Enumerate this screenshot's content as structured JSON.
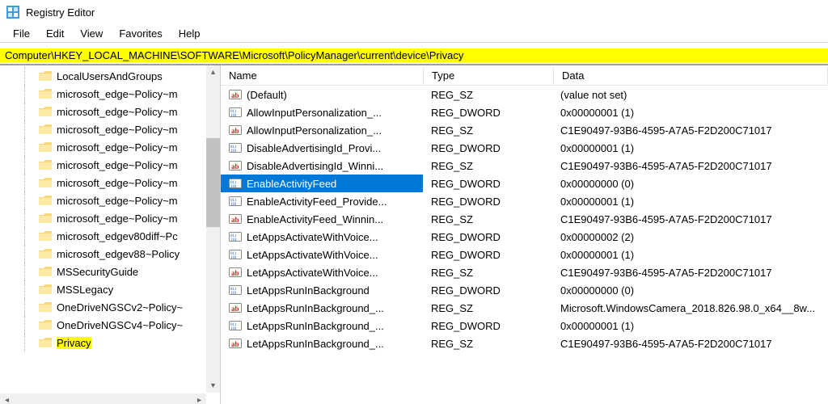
{
  "window": {
    "title": "Registry Editor"
  },
  "menu": {
    "items": [
      "File",
      "Edit",
      "View",
      "Favorites",
      "Help"
    ]
  },
  "address": {
    "path": "Computer\\HKEY_LOCAL_MACHINE\\SOFTWARE\\Microsoft\\PolicyManager\\current\\device\\Privacy"
  },
  "columns": {
    "name": "Name",
    "type": "Type",
    "data": "Data"
  },
  "tree": {
    "items": [
      {
        "label": "LocalUsersAndGroups",
        "selected": false
      },
      {
        "label": "microsoft_edge~Policy~m",
        "selected": false
      },
      {
        "label": "microsoft_edge~Policy~m",
        "selected": false
      },
      {
        "label": "microsoft_edge~Policy~m",
        "selected": false
      },
      {
        "label": "microsoft_edge~Policy~m",
        "selected": false
      },
      {
        "label": "microsoft_edge~Policy~m",
        "selected": false
      },
      {
        "label": "microsoft_edge~Policy~m",
        "selected": false
      },
      {
        "label": "microsoft_edge~Policy~m",
        "selected": false
      },
      {
        "label": "microsoft_edge~Policy~m",
        "selected": false
      },
      {
        "label": "microsoft_edgev80diff~Pc",
        "selected": false
      },
      {
        "label": "microsoft_edgev88~Policy",
        "selected": false
      },
      {
        "label": "MSSecurityGuide",
        "selected": false
      },
      {
        "label": "MSSLegacy",
        "selected": false
      },
      {
        "label": "OneDriveNGSCv2~Policy~",
        "selected": false
      },
      {
        "label": "OneDriveNGSCv4~Policy~",
        "selected": false
      },
      {
        "label": "Privacy",
        "selected": true
      }
    ]
  },
  "values": [
    {
      "icon": "sz",
      "name": "(Default)",
      "type": "REG_SZ",
      "data": "(value not set)",
      "selected": false
    },
    {
      "icon": "dword",
      "name": "AllowInputPersonalization_...",
      "type": "REG_DWORD",
      "data": "0x00000001 (1)",
      "selected": false
    },
    {
      "icon": "sz",
      "name": "AllowInputPersonalization_...",
      "type": "REG_SZ",
      "data": "C1E90497-93B6-4595-A7A5-F2D200C71017",
      "selected": false
    },
    {
      "icon": "dword",
      "name": "DisableAdvertisingId_Provi...",
      "type": "REG_DWORD",
      "data": "0x00000001 (1)",
      "selected": false
    },
    {
      "icon": "sz",
      "name": "DisableAdvertisingId_Winni...",
      "type": "REG_SZ",
      "data": "C1E90497-93B6-4595-A7A5-F2D200C71017",
      "selected": false
    },
    {
      "icon": "dword",
      "name": "EnableActivityFeed",
      "type": "REG_DWORD",
      "data": "0x00000000 (0)",
      "selected": true
    },
    {
      "icon": "dword",
      "name": "EnableActivityFeed_Provide...",
      "type": "REG_DWORD",
      "data": "0x00000001 (1)",
      "selected": false
    },
    {
      "icon": "sz",
      "name": "EnableActivityFeed_Winnin...",
      "type": "REG_SZ",
      "data": "C1E90497-93B6-4595-A7A5-F2D200C71017",
      "selected": false
    },
    {
      "icon": "dword",
      "name": "LetAppsActivateWithVoice...",
      "type": "REG_DWORD",
      "data": "0x00000002 (2)",
      "selected": false
    },
    {
      "icon": "dword",
      "name": "LetAppsActivateWithVoice...",
      "type": "REG_DWORD",
      "data": "0x00000001 (1)",
      "selected": false
    },
    {
      "icon": "sz",
      "name": "LetAppsActivateWithVoice...",
      "type": "REG_SZ",
      "data": "C1E90497-93B6-4595-A7A5-F2D200C71017",
      "selected": false
    },
    {
      "icon": "dword",
      "name": "LetAppsRunInBackground",
      "type": "REG_DWORD",
      "data": "0x00000000 (0)",
      "selected": false
    },
    {
      "icon": "sz",
      "name": "LetAppsRunInBackground_...",
      "type": "REG_SZ",
      "data": "Microsoft.WindowsCamera_2018.826.98.0_x64__8w...",
      "selected": false
    },
    {
      "icon": "dword",
      "name": "LetAppsRunInBackground_...",
      "type": "REG_DWORD",
      "data": "0x00000001 (1)",
      "selected": false
    },
    {
      "icon": "sz",
      "name": "LetAppsRunInBackground_...",
      "type": "REG_SZ",
      "data": "C1E90497-93B6-4595-A7A5-F2D200C71017",
      "selected": false
    }
  ]
}
